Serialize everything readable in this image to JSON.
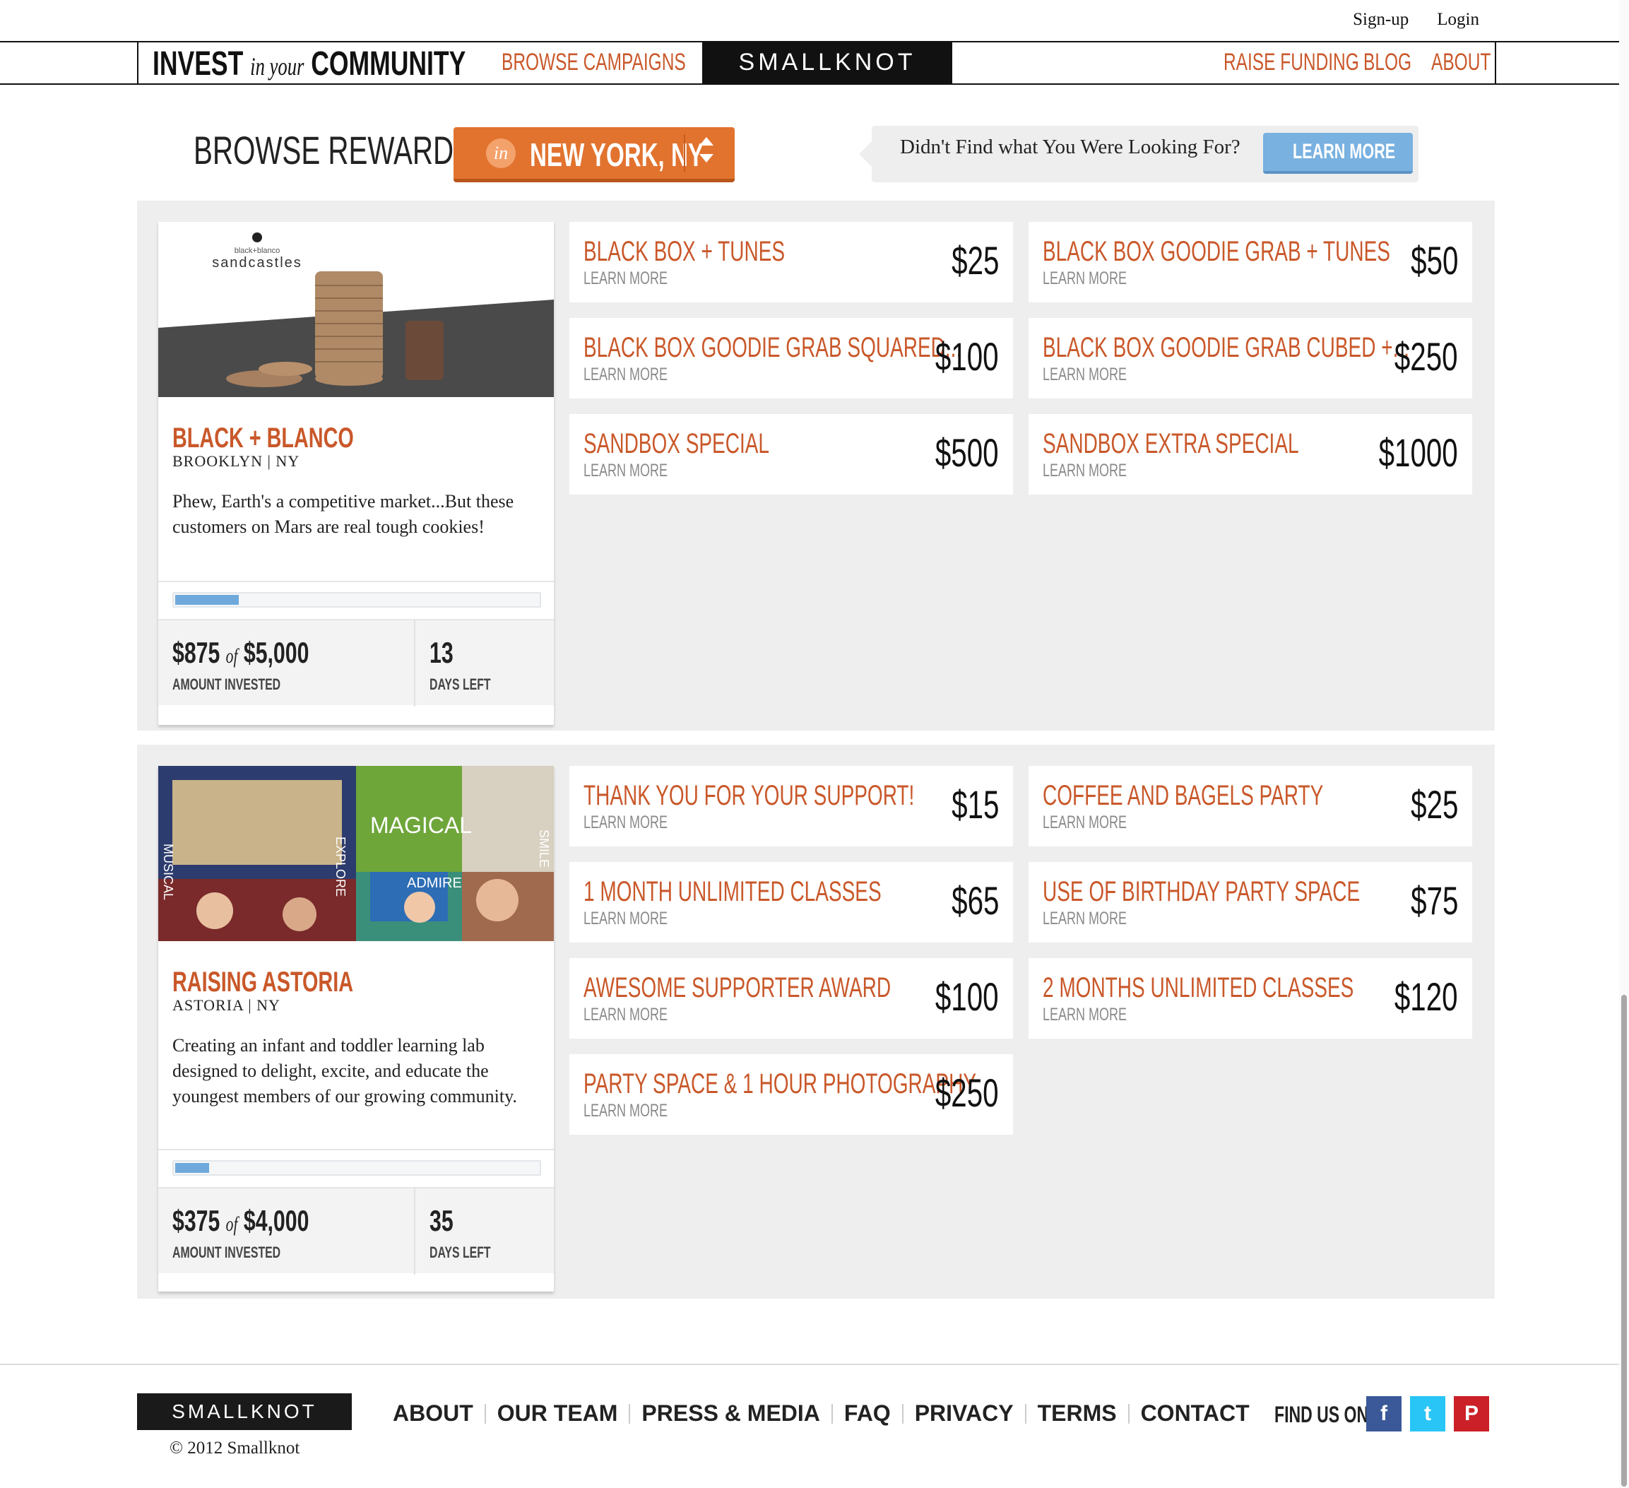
{
  "util_links": {
    "signup": "Sign-up",
    "login": "Login"
  },
  "header": {
    "tagline_invest": "INVEST",
    "tagline_inyour": "in your",
    "tagline_community": "COMMUNITY",
    "browse_campaigns": "BROWSE CAMPAIGNS",
    "logo": "SMALLKNOT",
    "raise_funding": "RAISE FUNDING",
    "blog": "BLOG",
    "about": "ABOUT"
  },
  "browse": {
    "title": "BROWSE REWARDS",
    "city_icon": "in",
    "city": "NEW YORK, NY",
    "notice_text": "Didn't Find what You Were Looking For?",
    "learn_more_button": "LEARN MORE"
  },
  "campaigns": [
    {
      "image_label": "black+blanco sandcastles",
      "image_brand_top": "black+blanco",
      "image_brand_name": "sandcastles",
      "title": "BLACK + BLANCO",
      "location": "BROOKLYN | NY",
      "description": "Phew, Earth's a competitive market...But these customers on Mars are real tough cookies!",
      "progress": 0.175,
      "amount_raised": "$875",
      "amount_of": "of",
      "amount_goal": "$5,000",
      "amount_label": "AMOUNT INVESTED",
      "days_left": "13",
      "days_label": "DAYS LEFT",
      "rewards": [
        {
          "title": "BLACK BOX + TUNES",
          "learn": "LEARN MORE",
          "price": "$25"
        },
        {
          "title": "BLACK BOX GOODIE GRAB + TUNES",
          "learn": "LEARN MORE",
          "price": "$50"
        },
        {
          "title": "BLACK BOX GOODIE GRAB SQUARED...",
          "learn": "LEARN MORE",
          "price": "$100"
        },
        {
          "title": "BLACK BOX GOODIE GRAB CUBED +...",
          "learn": "LEARN MORE",
          "price": "$250"
        },
        {
          "title": "SANDBOX SPECIAL",
          "learn": "LEARN MORE",
          "price": "$500"
        },
        {
          "title": "SANDBOX EXTRA SPECIAL",
          "learn": "LEARN MORE",
          "price": "$1000"
        }
      ]
    },
    {
      "image_label": "Raising Astoria collage",
      "image_words": [
        "MAGICAL",
        "ADMIRE",
        "EXPLORE",
        "MUSICAL",
        "SMILE"
      ],
      "title": "RAISING ASTORIA",
      "location": "ASTORIA | NY",
      "description": "Creating an infant and toddler learning lab designed to delight, excite, and educate the youngest members of our growing community.",
      "progress": 0.09375,
      "amount_raised": "$375",
      "amount_of": "of",
      "amount_goal": "$4,000",
      "amount_label": "AMOUNT INVESTED",
      "days_left": "35",
      "days_label": "DAYS LEFT",
      "rewards": [
        {
          "title": "THANK YOU FOR YOUR SUPPORT!",
          "learn": "LEARN MORE",
          "price": "$15"
        },
        {
          "title": "COFFEE AND BAGELS PARTY",
          "learn": "LEARN MORE",
          "price": "$25"
        },
        {
          "title": "1 MONTH UNLIMITED CLASSES",
          "learn": "LEARN MORE",
          "price": "$65"
        },
        {
          "title": "USE OF BIRTHDAY PARTY SPACE",
          "learn": "LEARN MORE",
          "price": "$75"
        },
        {
          "title": "AWESOME SUPPORTER AWARD",
          "learn": "LEARN MORE",
          "price": "$100"
        },
        {
          "title": "2 MONTHS UNLIMITED CLASSES",
          "learn": "LEARN MORE",
          "price": "$120"
        },
        {
          "title": "PARTY SPACE & 1 HOUR PHOTOGRAPHY",
          "learn": "LEARN MORE",
          "price": "$250"
        }
      ]
    }
  ],
  "footer": {
    "logo": "SMALLKNOT",
    "copyright": "© 2012 Smallknot",
    "links": [
      "ABOUT",
      "OUR TEAM",
      "PRESS & MEDIA",
      "FAQ",
      "PRIVACY",
      "TERMS",
      "CONTACT"
    ],
    "find_us": "FIND US ON",
    "social": [
      {
        "name": "facebook-icon",
        "glyph": "f",
        "color": "#3b5998"
      },
      {
        "name": "twitter-icon",
        "glyph": "t",
        "color": "#29c5f6"
      },
      {
        "name": "pinterest-icon",
        "glyph": "P",
        "color": "#cb2027"
      }
    ]
  },
  "colors": {
    "accent": "#c9582a",
    "city_button": "#e2732f",
    "learn_button": "#79b1e0",
    "panel": "#eeeeee"
  }
}
